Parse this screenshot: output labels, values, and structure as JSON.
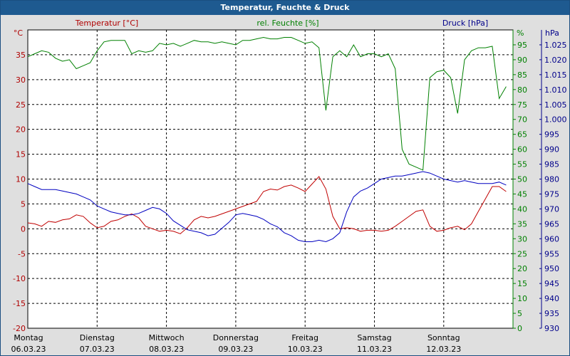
{
  "chart_data": {
    "type": "line",
    "title": "Temperatur, Feuchte & Druck",
    "x_days": [
      {
        "day": "Montag",
        "date": "06.03.23"
      },
      {
        "day": "Dienstag",
        "date": "07.03.23"
      },
      {
        "day": "Mittwoch",
        "date": "08.03.23"
      },
      {
        "day": "Donnerstag",
        "date": "09.03.23"
      },
      {
        "day": "Freitag",
        "date": "10.03.23"
      },
      {
        "day": "Samstag",
        "date": "11.03.23"
      },
      {
        "day": "Sonntag",
        "date": "12.03.23"
      }
    ],
    "axes": {
      "temperature": {
        "label": "Temperatur [°C]",
        "unit": "°C",
        "min": -20,
        "max": 40,
        "ticks": [
          -20,
          -15,
          -10,
          -5,
          0,
          5,
          10,
          15,
          20,
          25,
          30,
          35
        ],
        "color": "#b00000"
      },
      "humidity": {
        "label": "rel. Feuchte [%]",
        "unit": "%",
        "min": 0,
        "max": 100,
        "ticks": [
          0,
          5,
          10,
          15,
          20,
          25,
          30,
          35,
          40,
          45,
          50,
          55,
          60,
          65,
          70,
          75,
          80,
          85,
          90,
          95
        ],
        "color": "#008000"
      },
      "pressure": {
        "label": "Druck [hPa]",
        "unit": "hPa",
        "min": 930,
        "max": 1030,
        "ticks": [
          "930",
          "935",
          "940",
          "945",
          "950",
          "955",
          "960",
          "965",
          "970",
          "975",
          "980",
          "985",
          "990",
          "995",
          "1.000",
          "1.005",
          "1.010",
          "1.015",
          "1.020",
          "1.025"
        ],
        "color": "#00008b"
      }
    },
    "grid": true,
    "series": [
      {
        "name": "Temperatur [°C]",
        "axis": "temperature",
        "color": "#c00000",
        "x": [
          0,
          0.1,
          0.2,
          0.3,
          0.4,
          0.5,
          0.6,
          0.7,
          0.8,
          0.9,
          1.0,
          1.1,
          1.2,
          1.3,
          1.4,
          1.5,
          1.6,
          1.7,
          1.8,
          1.9,
          2.0,
          2.1,
          2.2,
          2.3,
          2.4,
          2.5,
          2.6,
          2.7,
          2.8,
          2.9,
          3.0,
          3.1,
          3.2,
          3.3,
          3.4,
          3.5,
          3.6,
          3.7,
          3.8,
          3.9,
          4.0,
          4.1,
          4.2,
          4.3,
          4.4,
          4.5,
          4.6,
          4.7,
          4.8,
          4.9,
          5.0,
          5.1,
          5.2,
          5.3,
          5.4,
          5.5,
          5.6,
          5.7,
          5.8,
          5.9,
          6.0,
          6.1,
          6.2,
          6.3,
          6.4,
          6.5,
          6.6,
          6.7,
          6.8,
          6.9
        ],
        "values": [
          1.2,
          1.0,
          0.5,
          1.5,
          1.3,
          1.8,
          2.0,
          2.8,
          2.5,
          1.2,
          0.2,
          0.5,
          1.5,
          1.8,
          2.5,
          3.0,
          2.2,
          0.5,
          0.0,
          -0.5,
          -0.3,
          -0.5,
          -1.0,
          0.2,
          1.8,
          2.5,
          2.2,
          2.5,
          3.0,
          3.5,
          4.0,
          4.5,
          5.0,
          5.5,
          7.5,
          8.0,
          7.8,
          8.5,
          8.8,
          8.2,
          7.5,
          9.0,
          10.5,
          8.0,
          2.5,
          0.0,
          0.2,
          0.0,
          -0.5,
          -0.3,
          -0.3,
          -0.5,
          -0.3,
          0.5,
          1.5,
          2.5,
          3.5,
          3.8,
          0.5,
          -0.5,
          -0.3,
          0.2,
          0.5,
          -0.2,
          1.0,
          3.5,
          6.0,
          8.5,
          8.5,
          7.5
        ]
      },
      {
        "name": "rel. Feuchte [%]",
        "axis": "humidity",
        "color": "#008000",
        "x": [
          0,
          0.1,
          0.2,
          0.3,
          0.4,
          0.5,
          0.6,
          0.7,
          0.8,
          0.9,
          1.0,
          1.1,
          1.2,
          1.3,
          1.4,
          1.5,
          1.6,
          1.7,
          1.8,
          1.9,
          2.0,
          2.1,
          2.2,
          2.3,
          2.4,
          2.5,
          2.6,
          2.7,
          2.8,
          2.9,
          3.0,
          3.1,
          3.2,
          3.3,
          3.4,
          3.5,
          3.6,
          3.7,
          3.8,
          3.9,
          4.0,
          4.1,
          4.2,
          4.3,
          4.4,
          4.5,
          4.6,
          4.7,
          4.8,
          4.9,
          5.0,
          5.1,
          5.2,
          5.3,
          5.4,
          5.5,
          5.6,
          5.7,
          5.8,
          5.9,
          6.0,
          6.1,
          6.2,
          6.3,
          6.4,
          6.5,
          6.6,
          6.7,
          6.8,
          6.9
        ],
        "values": [
          91.0,
          92.0,
          93.0,
          92.5,
          90.5,
          89.5,
          90.0,
          87.0,
          88.0,
          89.0,
          93.0,
          96.0,
          96.5,
          96.5,
          96.5,
          92.0,
          93.0,
          92.5,
          93.0,
          95.5,
          95.0,
          95.5,
          94.5,
          95.5,
          96.5,
          96.0,
          96.0,
          95.5,
          96.0,
          95.5,
          95.0,
          96.5,
          96.5,
          97.0,
          97.5,
          97.0,
          97.0,
          97.5,
          97.5,
          96.5,
          95.5,
          96.0,
          94.0,
          73.0,
          91.0,
          93.0,
          91.0,
          95.0,
          91.0,
          92.0,
          92.0,
          91.0,
          92.0,
          87.0,
          60.0,
          55.0,
          54.0,
          53.0,
          84.0,
          86.0,
          86.5,
          84.0,
          72.0,
          90.0,
          93.0,
          94.0,
          94.0,
          94.5,
          77.0,
          81.0
        ],
        "y_approx_note": null
      },
      {
        "name": "Druck [hPa]",
        "axis": "pressure",
        "color": "#0000c0",
        "x": [
          0,
          0.1,
          0.2,
          0.3,
          0.4,
          0.5,
          0.6,
          0.7,
          0.8,
          0.9,
          1.0,
          1.1,
          1.2,
          1.3,
          1.4,
          1.5,
          1.6,
          1.7,
          1.8,
          1.9,
          2.0,
          2.1,
          2.2,
          2.3,
          2.4,
          2.5,
          2.6,
          2.7,
          2.8,
          2.9,
          3.0,
          3.1,
          3.2,
          3.3,
          3.4,
          3.5,
          3.6,
          3.7,
          3.8,
          3.9,
          4.0,
          4.1,
          4.2,
          4.3,
          4.4,
          4.5,
          4.6,
          4.7,
          4.8,
          4.9,
          5.0,
          5.1,
          5.2,
          5.3,
          5.4,
          5.5,
          5.6,
          5.7,
          5.8,
          5.9,
          6.0,
          6.1,
          6.2,
          6.3,
          6.4,
          6.5,
          6.6,
          6.7,
          6.8,
          6.9
        ],
        "values": [
          978.5,
          977.5,
          976.5,
          976.5,
          976.5,
          976.0,
          975.5,
          975.0,
          974.0,
          973.0,
          971.0,
          970.0,
          969.0,
          968.5,
          968.0,
          968.0,
          968.5,
          969.5,
          970.5,
          970.0,
          968.5,
          966.0,
          964.5,
          963.0,
          962.5,
          962.0,
          961.0,
          961.5,
          963.5,
          965.5,
          968.0,
          968.5,
          968.0,
          967.5,
          966.5,
          965.0,
          964.0,
          962.0,
          961.0,
          959.5,
          959.0,
          959.0,
          959.5,
          959.0,
          960.0,
          962.0,
          969.0,
          974.0,
          976.0,
          977.0,
          978.5,
          980.0,
          980.5,
          981.0,
          981.0,
          981.5,
          982.0,
          982.5,
          982.0,
          981.0,
          980.0,
          979.5,
          979.0,
          979.5,
          979.0,
          978.5,
          978.5,
          978.5,
          979.0,
          978.0
        ]
      }
    ]
  }
}
